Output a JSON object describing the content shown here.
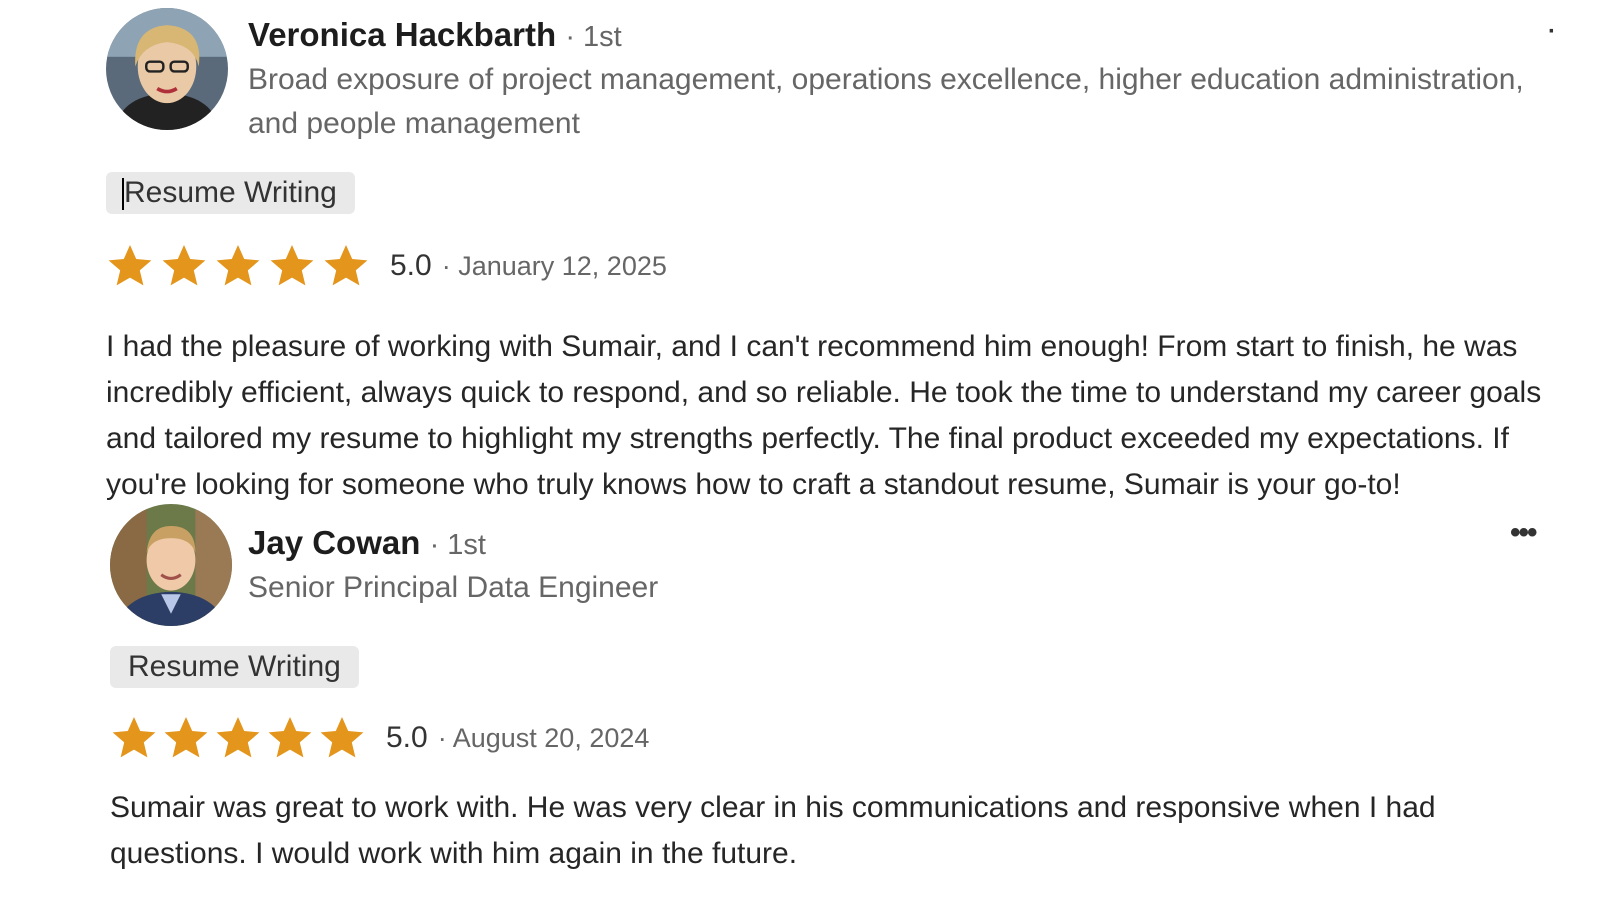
{
  "reviews": [
    {
      "name": "Veronica Hackbarth",
      "degree": "· 1st",
      "headline": "Broad exposure of project management, operations excellence, higher education administration, and people management",
      "service": "Resume Writing",
      "rating": 5,
      "score": "5.0",
      "date": "· January 12, 2025",
      "text": "I had the pleasure of working with Sumair, and I can't recommend him enough! From start to finish, he was incredibly efficient, always quick to respond, and so reliable. He took the time to understand my career goals and tailored my resume to highlight my strengths perfectly. The final product exceeded my expectations. If you're looking for someone who truly knows how to craft a standout resume, Sumair is your go-to!",
      "menu_icon": "more-options-icon"
    },
    {
      "name": "Jay Cowan",
      "degree": "· 1st",
      "headline": "Senior Principal Data Engineer",
      "service": "Resume Writing",
      "rating": 5,
      "score": "5.0",
      "date": "· August 20, 2024",
      "text": "Sumair was great to work with. He was very clear in his communications and responsive when I had questions. I would work with him again in the future.",
      "menu_icon": "more-options-icon"
    }
  ],
  "colors": {
    "star": "#e3951c",
    "pill_bg": "#e9e9e9",
    "muted_text": "#666666"
  }
}
